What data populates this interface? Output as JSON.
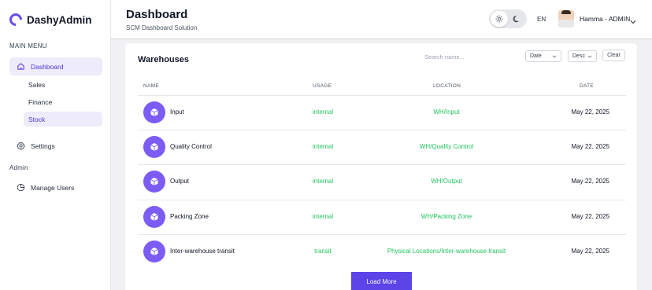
{
  "brand": {
    "name": "DashyAdmin",
    "accent": "#6d4cf3"
  },
  "sidebar": {
    "main_menu_label": "MAIN MENU",
    "admin_label": "Admin",
    "items": [
      {
        "label": "Dashboard",
        "icon": "dashboard-icon",
        "active": true
      },
      {
        "label": "Sales"
      },
      {
        "label": "Finance"
      },
      {
        "label": "Stock",
        "active": true
      },
      {
        "label": "Settings",
        "icon": "gear-icon"
      },
      {
        "label": "Manage Users",
        "icon": "pie-chart-icon"
      }
    ]
  },
  "header": {
    "title": "Dashboard",
    "subtitle": "SCM Dashboard Solution",
    "language": "EN",
    "user": "Hamma - ADMIN"
  },
  "warehouses": {
    "title": "Warehouses",
    "search_placeholder": "Search name...",
    "sort_field": "Date",
    "sort_order": "Desc",
    "clear_label": "Clear",
    "columns": [
      "NAME",
      "USAGE",
      "LOCATION",
      "DATE"
    ],
    "rows": [
      {
        "name": "Input",
        "usage": "internal",
        "location": "WH/Input",
        "date": "May 22, 2025"
      },
      {
        "name": "Quality Control",
        "usage": "internal",
        "location": "WH/Quality Control",
        "date": "May 22, 2025"
      },
      {
        "name": "Output",
        "usage": "internal",
        "location": "WH/Output",
        "date": "May 22, 2025"
      },
      {
        "name": "Packing Zone",
        "usage": "internal",
        "location": "WH/Packing Zone",
        "date": "May 22, 2025"
      },
      {
        "name": "Inter-warehouse transit",
        "usage": "transit",
        "location": "Physical Locations/Inter-warehouse transit",
        "date": "May 22, 2025"
      }
    ],
    "load_more_label": "Load More",
    "status_color": "#22c55e"
  }
}
